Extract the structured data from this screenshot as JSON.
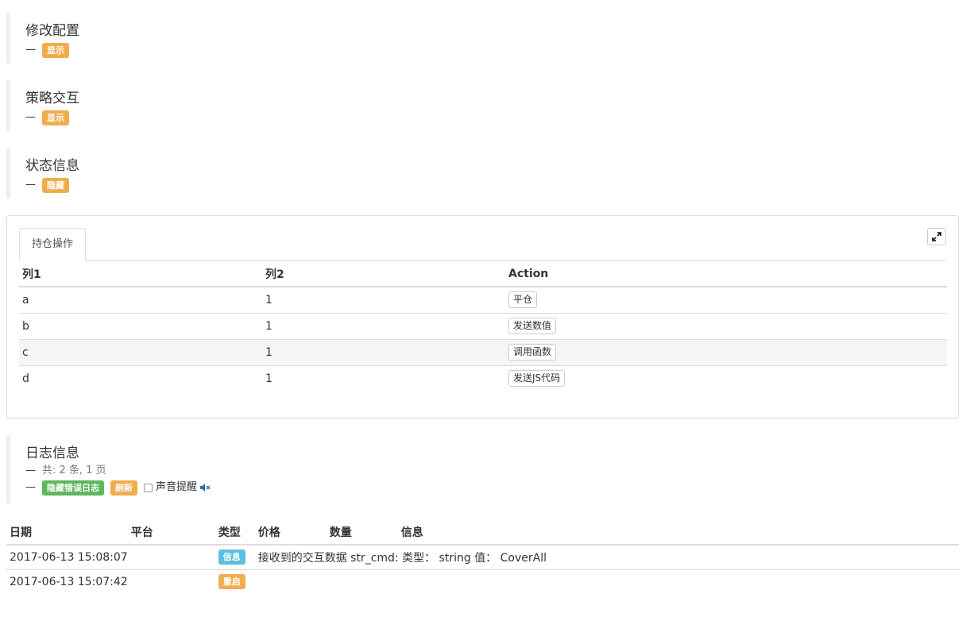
{
  "sections": [
    {
      "title": "修改配置",
      "dash": "—",
      "toggle": "显示"
    },
    {
      "title": "策略交互",
      "dash": "—",
      "toggle": "显示"
    },
    {
      "title": "状态信息",
      "dash": "—",
      "toggle": "隐藏"
    }
  ],
  "positions": {
    "tab": "持仓操作",
    "columns": [
      "列1",
      "列2",
      "Action"
    ],
    "rows": [
      {
        "c1": "a",
        "c2": "1",
        "action": "平仓"
      },
      {
        "c1": "b",
        "c2": "1",
        "action": "发送数值"
      },
      {
        "c1": "c",
        "c2": "1",
        "action": "调用函数"
      },
      {
        "c1": "d",
        "c2": "1",
        "action": "发送JS代码"
      }
    ]
  },
  "logs": {
    "title": "日志信息",
    "dash": "—",
    "summary": "共: 2 条, 1 页",
    "hide_errors": "隐藏错误日志",
    "refresh": "刷新",
    "sound": "声音提醒",
    "columns": [
      "日期",
      "平台",
      "类型",
      "价格",
      "数量",
      "信息"
    ],
    "rows": [
      {
        "date": "2017-06-13 15:08:07",
        "platform": "",
        "type": "信息",
        "type_color": "#5bc0de",
        "price": "",
        "amount": "",
        "info": "接收到的交互数据 str_cmd: 类型： string 值： CoverAll"
      },
      {
        "date": "2017-06-13 15:07:42",
        "platform": "",
        "type": "重启",
        "type_color": "#f0ad4e",
        "price": "",
        "amount": "",
        "info": ""
      }
    ]
  }
}
